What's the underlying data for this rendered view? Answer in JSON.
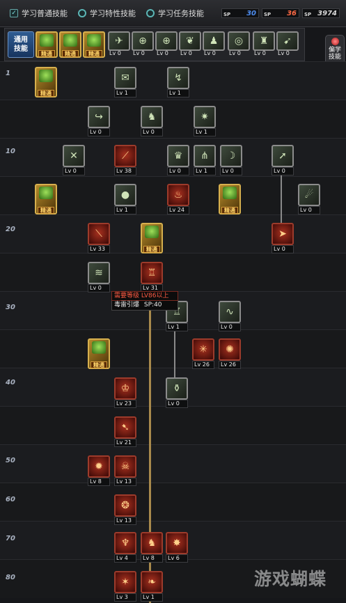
{
  "tabs": [
    {
      "label": "学习普通技能",
      "selected": true
    },
    {
      "label": "学习特性技能",
      "selected": false
    },
    {
      "label": "学习任务技能",
      "selected": false
    }
  ],
  "sp_counters": [
    {
      "tag": "SP",
      "value": "30",
      "color": "#4e8df0"
    },
    {
      "tag": "SP",
      "value": "36",
      "color": "#ff6a45"
    },
    {
      "tag": "SP",
      "value": "3974",
      "color": "#d8d8d8"
    }
  ],
  "common_skills": {
    "label_line1": "通用",
    "label_line2": "技能",
    "items": [
      {
        "type": "mastery",
        "text": "精通",
        "icon": "warrior-pose-icon"
      },
      {
        "type": "mastery",
        "text": "精通",
        "icon": "hand-icon"
      },
      {
        "type": "mastery",
        "text": "精通",
        "icon": "runner-icon"
      },
      {
        "type": "basic",
        "level": "Lv 0",
        "icon": "wings-icon"
      },
      {
        "type": "basic",
        "level": "Lv 0",
        "icon": "crosshair-icon"
      },
      {
        "type": "basic",
        "level": "Lv 0",
        "icon": "crosshair-icon"
      },
      {
        "type": "basic",
        "level": "Lv 0",
        "icon": "leaf-icon"
      },
      {
        "type": "basic",
        "level": "Lv 0",
        "icon": "figure-icon"
      },
      {
        "type": "basic",
        "level": "Lv 0",
        "icon": "swirl-icon"
      },
      {
        "type": "basic",
        "level": "Lv 0",
        "icon": "strongman-icon"
      },
      {
        "type": "basic",
        "level": "Lv 0",
        "icon": "dash-icon"
      }
    ]
  },
  "side_button": {
    "line1": "偏学",
    "line2": "技能"
  },
  "level_labels": [
    "1",
    "10",
    "20",
    "30",
    "40",
    "50",
    "60",
    "70",
    "80"
  ],
  "skills": [
    {
      "id": "s1",
      "type": "mastery",
      "text": "精通",
      "icon": "leaf-icon"
    },
    {
      "id": "s2",
      "type": "basic",
      "level": "Lv 1",
      "icon": "scroll-icon"
    },
    {
      "id": "s3",
      "type": "basic",
      "level": "Lv 1",
      "icon": "kick-icon"
    },
    {
      "id": "s4",
      "type": "basic",
      "level": "Lv 0",
      "icon": "hook-icon"
    },
    {
      "id": "s5",
      "type": "basic",
      "level": "Lv 0",
      "icon": "fighter-icon"
    },
    {
      "id": "s6",
      "type": "basic",
      "level": "Lv 1",
      "icon": "burst-icon"
    },
    {
      "id": "s7",
      "type": "basic",
      "level": "Lv 0",
      "icon": "cross-blades-icon"
    },
    {
      "id": "s8",
      "type": "red",
      "level": "Lv 38",
      "icon": "slash-icon"
    },
    {
      "id": "s9",
      "type": "basic",
      "level": "Lv 0",
      "icon": "armor-icon"
    },
    {
      "id": "s10",
      "type": "basic",
      "level": "Lv 1",
      "icon": "claw-icon"
    },
    {
      "id": "s11",
      "type": "basic",
      "level": "Lv 0",
      "icon": "bow-icon"
    },
    {
      "id": "s12",
      "type": "basic",
      "level": "Lv 0",
      "icon": "thrust-icon"
    },
    {
      "id": "s13",
      "type": "mastery",
      "text": "精通",
      "icon": "flame-icon"
    },
    {
      "id": "s14",
      "type": "basic",
      "level": "Lv 1",
      "icon": "bomb-icon"
    },
    {
      "id": "s15",
      "type": "red",
      "level": "Lv 24",
      "icon": "fire-icon"
    },
    {
      "id": "s16",
      "type": "mastery",
      "text": "精通",
      "icon": "muscle-icon"
    },
    {
      "id": "s17",
      "type": "basic",
      "level": "Lv 0",
      "icon": "fireball-icon"
    },
    {
      "id": "s18",
      "type": "red",
      "level": "Lv 33",
      "icon": "blade-icon"
    },
    {
      "id": "s19",
      "type": "mastery",
      "text": "精通",
      "icon": "book-icon"
    },
    {
      "id": "s20",
      "type": "red",
      "level": "Lv 0",
      "icon": "charge-icon"
    },
    {
      "id": "s21",
      "type": "basic",
      "level": "Lv 0",
      "icon": "strike-icon"
    },
    {
      "id": "s22",
      "type": "red",
      "level": "Lv 31",
      "icon": "totem-icon"
    },
    {
      "id": "s23",
      "type": "basic",
      "level": "Lv 1",
      "icon": "pillar-icon"
    },
    {
      "id": "s24",
      "type": "basic",
      "level": "Lv 0",
      "icon": "wave-icon"
    },
    {
      "id": "s25",
      "type": "mastery",
      "text": "精通",
      "icon": "fist-icon"
    },
    {
      "id": "s26",
      "type": "red",
      "level": "Lv 26",
      "icon": "web-icon"
    },
    {
      "id": "s27",
      "type": "red",
      "level": "Lv 26",
      "icon": "flare-icon"
    },
    {
      "id": "s28",
      "type": "red",
      "level": "Lv 23",
      "icon": "crown-icon"
    },
    {
      "id": "s29",
      "type": "basic",
      "level": "Lv 0",
      "icon": "jar-icon"
    },
    {
      "id": "s30",
      "type": "red",
      "level": "Lv 21",
      "icon": "swoop-icon"
    },
    {
      "id": "s31",
      "type": "red",
      "level": "Lv 8",
      "icon": "vortex-icon"
    },
    {
      "id": "s32",
      "type": "red",
      "level": "Lv 13",
      "icon": "skull-icon"
    },
    {
      "id": "s33",
      "type": "red",
      "level": "Lv 13",
      "icon": "spiral-icon"
    },
    {
      "id": "s34",
      "type": "red",
      "level": "Lv 4",
      "icon": "demon-icon"
    },
    {
      "id": "s35",
      "type": "red",
      "level": "Lv 8",
      "icon": "warrior-icon"
    },
    {
      "id": "s36",
      "type": "red",
      "level": "Lv 6",
      "icon": "star-burst-icon"
    },
    {
      "id": "s37",
      "type": "red",
      "level": "Lv 3",
      "icon": "eruption-icon"
    },
    {
      "id": "s38",
      "type": "red",
      "level": "Lv 1",
      "icon": "dragon-icon"
    }
  ],
  "tooltip": {
    "requirement": "需要等级 LV86以上",
    "skill_name": "毒雷引爆",
    "sp": "SP:40"
  },
  "watermark": "游戏蝴蝶"
}
